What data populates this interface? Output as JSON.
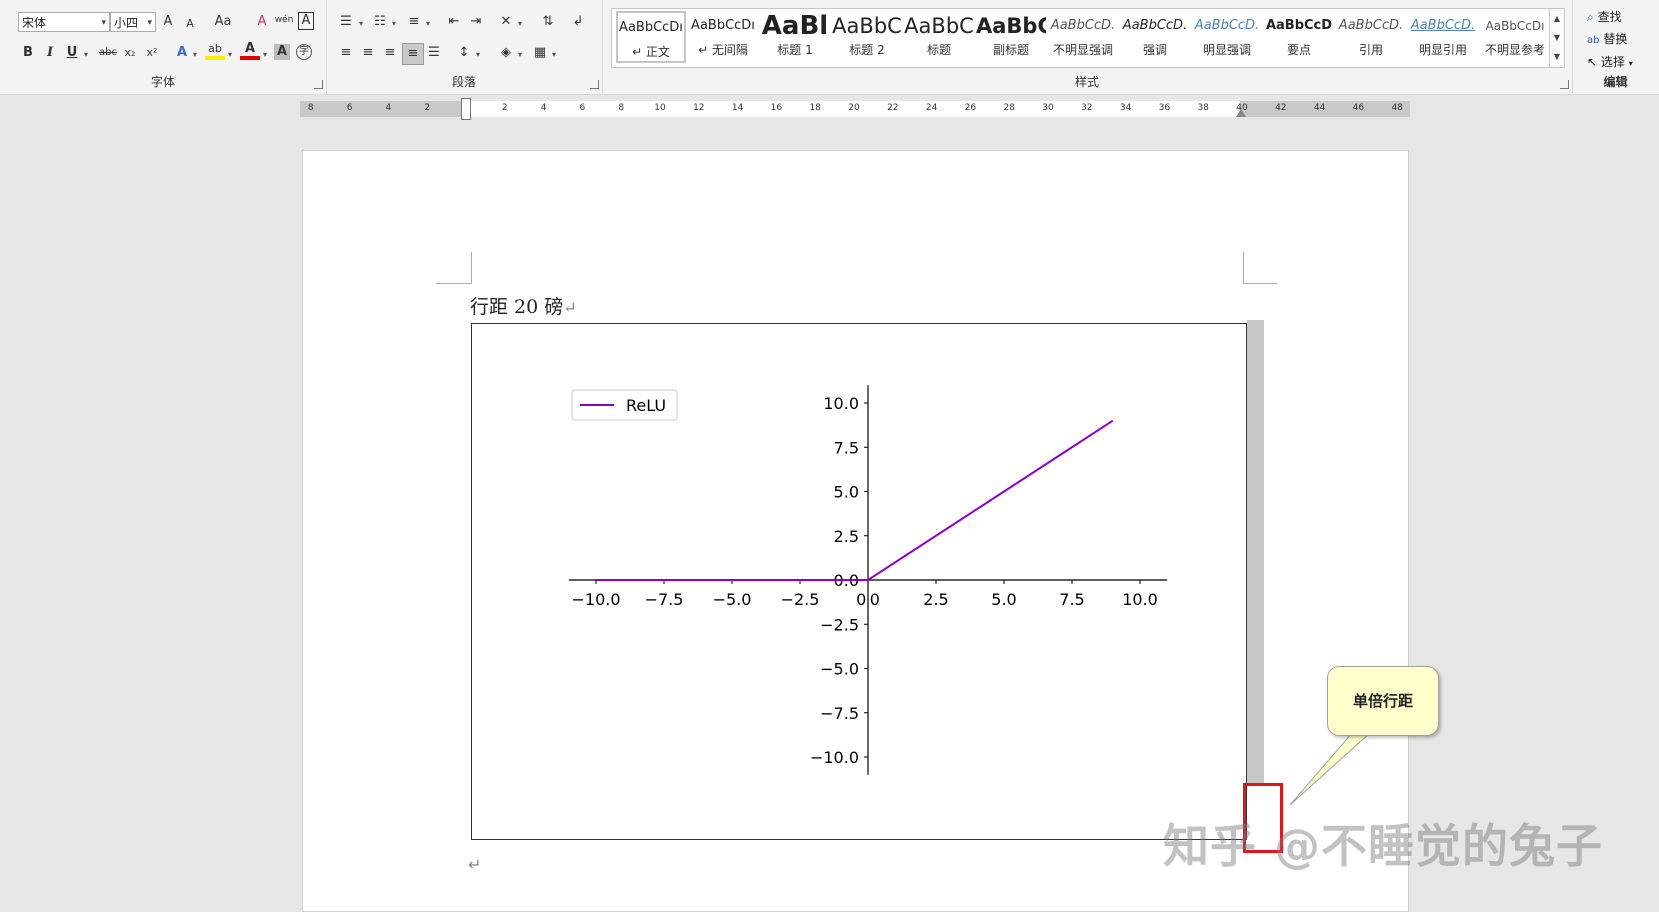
{
  "ribbon": {
    "font_group": {
      "label": "字体",
      "font_name": "宋体",
      "font_size": "小四",
      "grow_font": "A",
      "shrink_font": "A",
      "change_case": "Aa",
      "clear_format": "A",
      "phonetic": "wén",
      "char_border": "A",
      "bold": "B",
      "italic": "I",
      "underline": "U",
      "strike": "abc",
      "subscript": "x₂",
      "superscript": "x²",
      "text_effect": "A",
      "highlight": "ab",
      "font_color": "A",
      "char_shading": "A",
      "enclose": "字"
    },
    "paragraph_group": {
      "label": "段落"
    },
    "styles_group": {
      "label": "样式",
      "items": [
        {
          "preview": "AaBbCcDı",
          "label": "↵ 正文"
        },
        {
          "preview": "AaBbCcDı",
          "label": "↵ 无间隔"
        },
        {
          "preview": "AaBl",
          "label": "标题 1"
        },
        {
          "preview": "AaBbC",
          "label": "标题 2"
        },
        {
          "preview": "AaBbC",
          "label": "标题"
        },
        {
          "preview": "AaBbC",
          "label": "副标题"
        },
        {
          "preview": "AaBbCcD.",
          "label": "不明显强调"
        },
        {
          "preview": "AaBbCcD.",
          "label": "强调"
        },
        {
          "preview": "AaBbCcD.",
          "label": "明显强调"
        },
        {
          "preview": "AaBbCcD",
          "label": "要点"
        },
        {
          "preview": "AaBbCcD.",
          "label": "引用"
        },
        {
          "preview": "AaBbCcD.",
          "label": "明显引用"
        },
        {
          "preview": "AaBbCcDı",
          "label": "不明显参考"
        }
      ]
    },
    "editing_group": {
      "label": "编辑",
      "find": "查找",
      "replace": "替换",
      "select": "选择"
    }
  },
  "ruler": {
    "left_ticks": [
      "8",
      "6",
      "4",
      "2"
    ],
    "ticks": [
      "2",
      "4",
      "6",
      "8",
      "10",
      "12",
      "14",
      "16",
      "18",
      "20",
      "22",
      "24",
      "26",
      "28",
      "30",
      "32",
      "34",
      "36",
      "38",
      "40",
      "42",
      "44",
      "46",
      "48"
    ]
  },
  "document": {
    "para1_text": "行距 20 磅",
    "para_mark": "↵"
  },
  "callout": {
    "text": "单倍行距"
  },
  "watermark": {
    "text": "知乎 @不睡觉的兔子"
  },
  "chart_data": {
    "type": "line",
    "series": [
      {
        "name": "ReLU",
        "color": "#8b00c9",
        "x": [
          -10,
          -5,
          0,
          2.5,
          5,
          7.5,
          9
        ],
        "y": [
          0,
          0,
          0,
          2.5,
          5,
          7.5,
          9
        ]
      }
    ],
    "xlim": [
      -11,
      11
    ],
    "ylim": [
      -11,
      11
    ],
    "x_ticks": [
      -10,
      -7.5,
      -5,
      -2.5,
      0,
      2.5,
      5,
      7.5,
      10
    ],
    "y_ticks": [
      -10,
      -7.5,
      -5,
      -2.5,
      0,
      2.5,
      5,
      7.5,
      10
    ],
    "x_tick_labels": [
      "−10.0",
      "−7.5",
      "−5.0",
      "−2.5",
      "0",
      "0",
      "2.5",
      "5.0",
      "7.5",
      "10.0"
    ],
    "y_tick_labels": [
      "−10.0",
      "−7.5",
      "−5.0",
      "−2.5",
      "0.0",
      "2.5",
      "5.0",
      "7.5",
      "10.0"
    ],
    "spines": "centered",
    "legend": "top-left",
    "grid": false,
    "title": "",
    "xlabel": "",
    "ylabel": ""
  }
}
